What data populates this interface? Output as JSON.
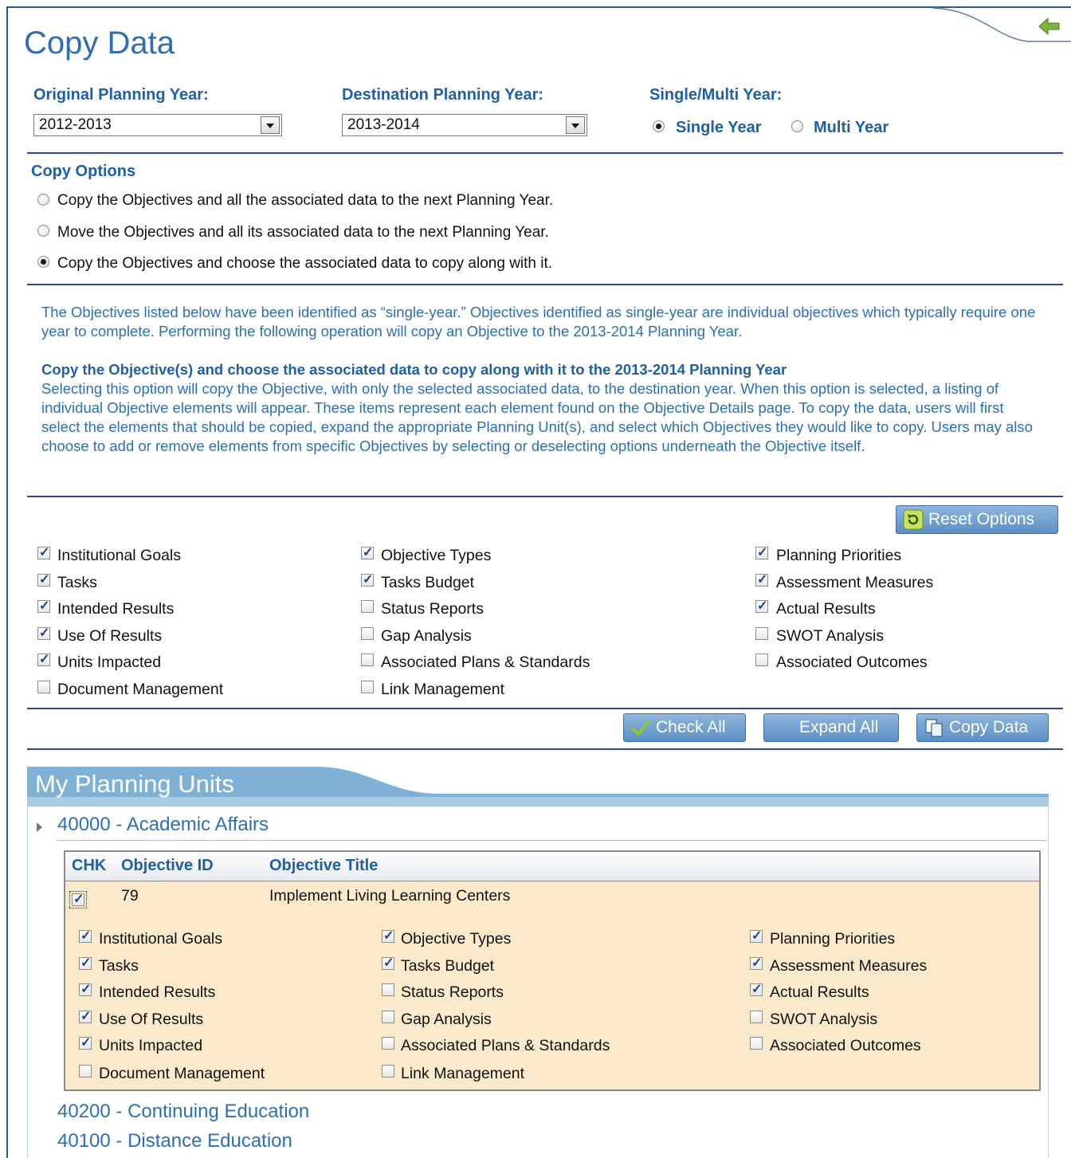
{
  "title": "Copy Data",
  "filters": {
    "original_label": "Original Planning Year:",
    "original_value": "2012-2013",
    "destination_label": "Destination Planning Year:",
    "destination_value": "2013-2014",
    "mode_label": "Single/Multi Year:",
    "single_label": "Single Year",
    "multi_label": "Multi Year",
    "selected_mode": "Single Year"
  },
  "copy_options": {
    "heading": "Copy Options",
    "options": [
      "Copy the Objectives and all the associated data to the next Planning Year.",
      "Move the Objectives and all its associated data to the next Planning Year.",
      "Copy the Objectives and choose the associated data to copy along with it."
    ],
    "selected_index": 2
  },
  "info": {
    "para1": "The Objectives listed below have been identified as “single-year.”  Objectives identified as single-year are individual objectives which typically require one year to complete. Performing the following operation will copy an Objective to the 2013-2014 Planning Year.",
    "heading2": "Copy the Objective(s) and choose the associated data to copy along with it to the 2013-2014 Planning Year",
    "para2": "Selecting this option will copy the Objective, with only the selected associated data, to the destination year. When this option is selected, a listing of individual Objective elements will appear. These items represent each element found on the Objective Details page. To copy the data, users will first select the elements that should be copied, expand the appropriate Planning Unit(s), and select which Objectives they would like to copy. Users may also choose to add or remove elements from specific Objectives by selecting or deselecting options underneath the Objective itself."
  },
  "buttons": {
    "reset": "Reset Options",
    "check_all": "Check All",
    "expand_all": "Expand All",
    "copy_data": "Copy Data"
  },
  "elements": {
    "col1": [
      {
        "label": "Institutional Goals",
        "checked": true
      },
      {
        "label": "Tasks",
        "checked": true
      },
      {
        "label": "Intended Results",
        "checked": true
      },
      {
        "label": "Use Of Results",
        "checked": true
      },
      {
        "label": "Units Impacted",
        "checked": true
      },
      {
        "label": "Document Management",
        "checked": false
      }
    ],
    "col2": [
      {
        "label": "Objective Types",
        "checked": true
      },
      {
        "label": "Tasks Budget",
        "checked": true
      },
      {
        "label": "Status Reports",
        "checked": false
      },
      {
        "label": "Gap Analysis",
        "checked": false
      },
      {
        "label": "Associated Plans & Standards",
        "checked": false
      },
      {
        "label": "Link Management",
        "checked": false
      }
    ],
    "col3": [
      {
        "label": "Planning Priorities",
        "checked": true
      },
      {
        "label": "Assessment Measures",
        "checked": true
      },
      {
        "label": "Actual Results",
        "checked": true
      },
      {
        "label": "SWOT Analysis",
        "checked": false
      },
      {
        "label": "Associated Outcomes",
        "checked": false
      }
    ]
  },
  "planning_units": {
    "heading": "My Planning Units",
    "units": [
      "40000 - Academic Affairs",
      "40200 - Continuing Education",
      "40100 - Distance Education"
    ],
    "table": {
      "columns": [
        "CHK",
        "Objective ID",
        "Objective Title"
      ],
      "row": {
        "checked": true,
        "id": "79",
        "title": "Implement Living Learning Centers"
      }
    }
  }
}
